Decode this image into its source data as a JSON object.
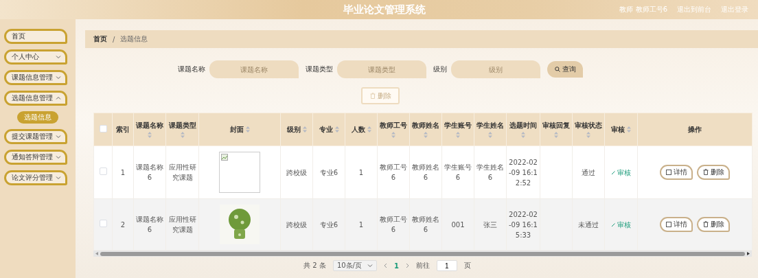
{
  "header": {
    "title": "毕业论文管理系统",
    "user": "教师 教师工号6",
    "links": [
      "退出到前台",
      "退出登录"
    ]
  },
  "sidebar": {
    "items": [
      {
        "label": "首页",
        "kind": "link",
        "selected": false
      },
      {
        "label": "个人中心",
        "kind": "group",
        "expanded": false
      },
      {
        "label": "课题信息管理",
        "kind": "group",
        "expanded": false
      },
      {
        "label": "选题信息管理",
        "kind": "group",
        "expanded": true,
        "children": [
          {
            "label": "选题信息",
            "selected": true
          }
        ]
      },
      {
        "label": "提交课题管理",
        "kind": "group",
        "expanded": false
      },
      {
        "label": "通知答辩管理",
        "kind": "group",
        "expanded": false
      },
      {
        "label": "论文评分管理",
        "kind": "group",
        "expanded": false
      }
    ]
  },
  "breadcrumb": {
    "items": [
      "首页",
      "选题信息"
    ],
    "separator": "/"
  },
  "search": {
    "fields": [
      {
        "label": "课题名称",
        "placeholder": "课题名称"
      },
      {
        "label": "课题类型",
        "placeholder": "课题类型"
      },
      {
        "label": "级别",
        "placeholder": "级别"
      }
    ],
    "button": "查询"
  },
  "toolbar": {
    "delete_button": {
      "label": "删除",
      "disabled": true
    }
  },
  "table": {
    "columns": [
      {
        "label": "索引",
        "sortable": false
      },
      {
        "label": "课题名称",
        "sortable": true
      },
      {
        "label": "课题类型",
        "sortable": true
      },
      {
        "label": "封面",
        "sortable": true
      },
      {
        "label": "级别",
        "sortable": true
      },
      {
        "label": "专业",
        "sortable": true
      },
      {
        "label": "人数",
        "sortable": true
      },
      {
        "label": "教师工号",
        "sortable": true
      },
      {
        "label": "教师姓名",
        "sortable": true
      },
      {
        "label": "学生账号",
        "sortable": true
      },
      {
        "label": "学生姓名",
        "sortable": true
      },
      {
        "label": "选题时间",
        "sortable": true
      },
      {
        "label": "审核回复",
        "sortable": true
      },
      {
        "label": "审核状态",
        "sortable": true
      },
      {
        "label": "审核",
        "sortable": true
      },
      {
        "label": "操作",
        "sortable": false
      }
    ],
    "header_checked": false,
    "rows": [
      {
        "checked": false,
        "hover": false,
        "index": "1",
        "name": "课题名称6",
        "type": "应用性研究课题",
        "cover": {
          "kind": "broken"
        },
        "level": "跨校级",
        "major": "专业6",
        "count": "1",
        "teacher_id": "教师工号6",
        "teacher_name": "教师姓名6",
        "student_id": "学生账号6",
        "student_name": "学生姓名6",
        "time": "2022-02-09 16:12:52",
        "status": "通过",
        "review": "审核",
        "actions": [
          "详情",
          "删除"
        ]
      },
      {
        "checked": false,
        "hover": true,
        "index": "2",
        "name": "课题名称6",
        "type": "应用性研究课题",
        "cover": {
          "kind": "photo"
        },
        "level": "跨校级",
        "major": "专业6",
        "count": "1",
        "teacher_id": "教师工号6",
        "teacher_name": "教师姓名6",
        "student_id": "001",
        "student_name": "张三",
        "time": "2022-02-09 16:15:33",
        "status": "未通过",
        "review": "审核",
        "actions": [
          "详情",
          "删除"
        ]
      }
    ]
  },
  "pagination": {
    "total": "共 2 条",
    "page_size": "10条/页",
    "pages": [
      {
        "label": "1",
        "selected": true
      }
    ],
    "goto_label": "前往",
    "goto_value": "1",
    "goto_suffix": "页"
  }
}
